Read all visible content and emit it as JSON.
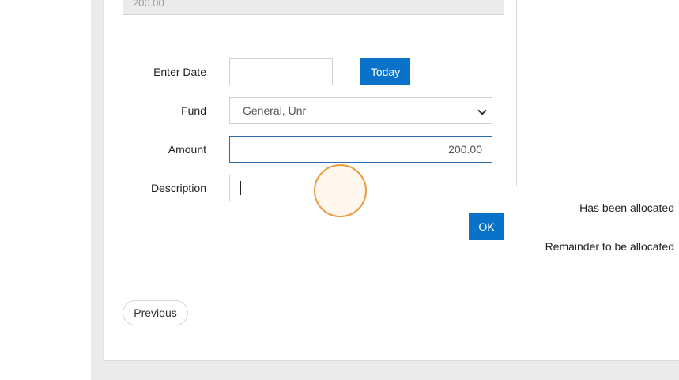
{
  "top_field": {
    "value": "200.00"
  },
  "form": {
    "enter_date": {
      "label": "Enter Date",
      "value": ""
    },
    "today_button": "Today",
    "fund": {
      "label": "Fund",
      "selected": "General, Unr"
    },
    "amount": {
      "label": "Amount",
      "value": "200.00"
    },
    "description": {
      "label": "Description",
      "value": ""
    },
    "ok_button": "OK"
  },
  "allocation": {
    "allocated_label": "Has been allocated",
    "remainder_label": "Remainder to be allocated"
  },
  "nav": {
    "previous_button": "Previous"
  },
  "colors": {
    "primary": "#0a73c9",
    "cursor_ring": "#ec9a3c"
  }
}
